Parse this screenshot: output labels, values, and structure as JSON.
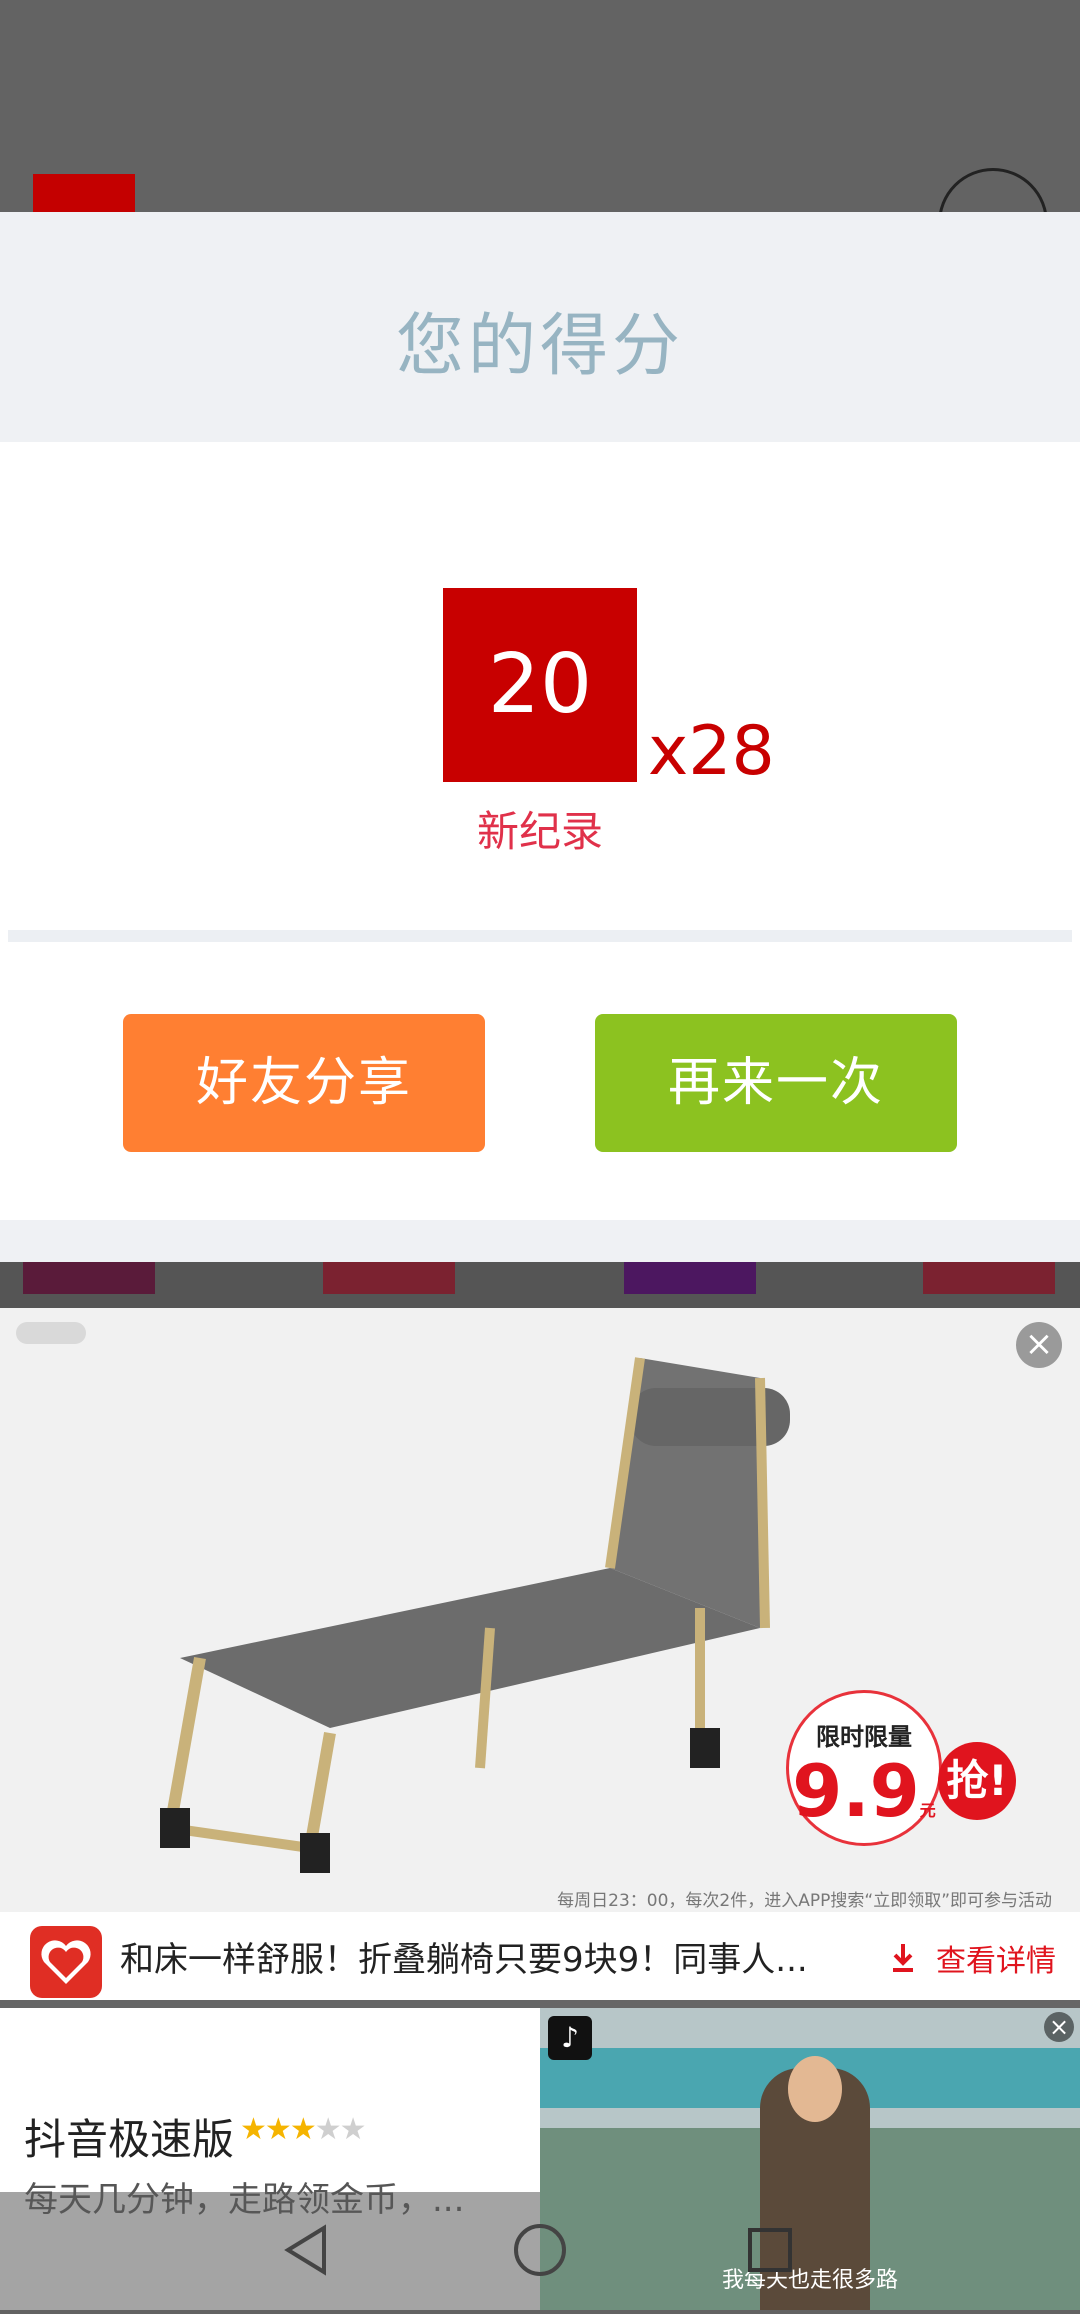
{
  "dialog": {
    "title": "您的得分",
    "score": "20",
    "multiplier": "x28",
    "record_label": "新纪录",
    "share_button": "好友分享",
    "retry_button": "再来一次"
  },
  "ad_one": {
    "close_icon": "close-icon",
    "price_tag": {
      "top": "限时限量",
      "price": "9.9",
      "unit": "元",
      "grab": "抢!"
    },
    "fine_print": "每周日23：00，每次2件，进入APP搜索“立即领取”即可参与活动",
    "headline": "和床一样舒服！折叠躺椅只要9块9！同事人...",
    "detail_link": "查看详情",
    "download_icon": "download-icon",
    "brand_icon": "pinduoduo-logo"
  },
  "ad_two": {
    "app_name": "抖音极速版",
    "rating": 3,
    "rating_max": 5,
    "description": "每天几分钟，走路领金币，...",
    "video_caption": "我每天也走很多路",
    "close_icon": "close-icon"
  },
  "navbar": {
    "back_icon": "back-icon",
    "home_icon": "home-icon",
    "recents_icon": "recents-icon"
  },
  "colors": {
    "score_red": "#c80000",
    "share_orange": "#ff7f32",
    "retry_green": "#8cc220",
    "record_red": "#e0314a"
  }
}
